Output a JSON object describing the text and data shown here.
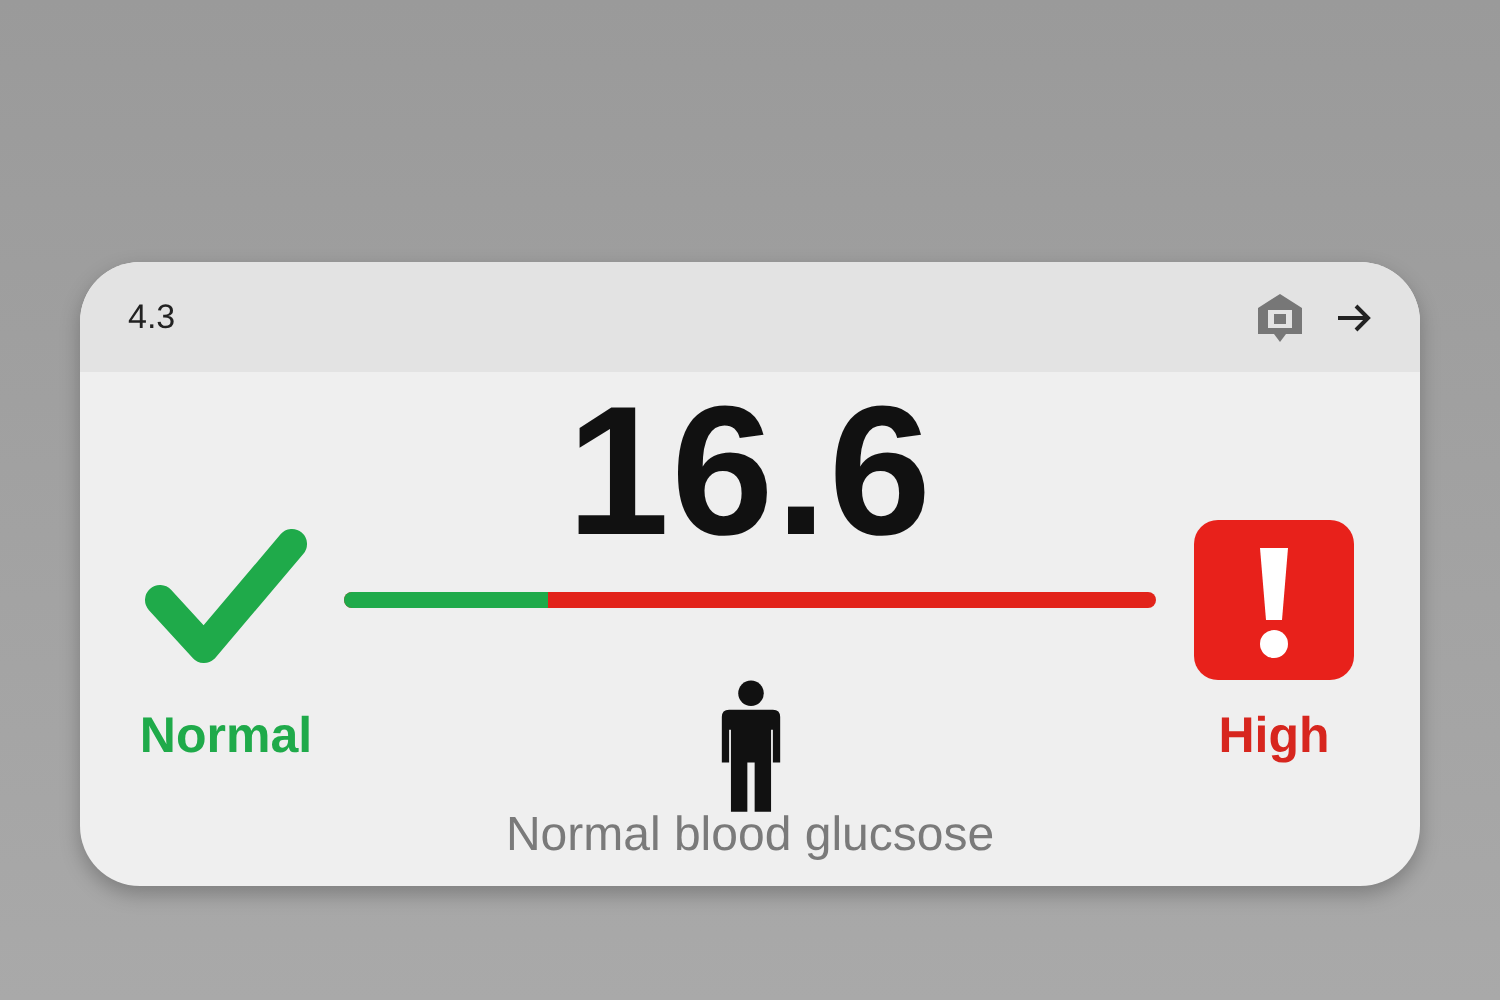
{
  "header": {
    "version": "4.3"
  },
  "reading": {
    "value": "16.6"
  },
  "scale": {
    "low_label": "Normal",
    "high_label": "High",
    "level": 0.25
  },
  "caption": "Normal blood glucsose"
}
